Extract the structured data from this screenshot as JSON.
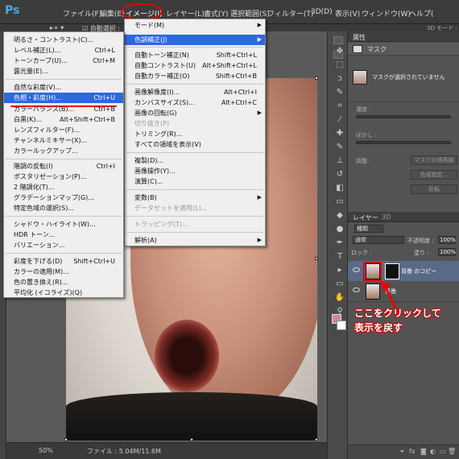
{
  "app": {
    "logo": "Ps",
    "menus": [
      "ファイル(F)",
      "編集(E)",
      "イメージ(I)",
      "レイヤー(L)",
      "書式(Y)",
      "選択範囲(S)",
      "フィルター(T)",
      "3D(D)",
      "表示(V)",
      "ウィンドウ(W)",
      "ヘルプ("
    ]
  },
  "options_bar": {
    "move_tool": "▸+ ▾",
    "auto_select": "☑ 自動選択 :",
    "mode_3d": "3D モード :"
  },
  "image_menu": {
    "items": [
      {
        "label": "モード(M)",
        "shortcut": "",
        "submenu": true,
        "disabled": false
      },
      {
        "label": "色調補正(J)",
        "shortcut": "",
        "submenu": true,
        "disabled": false,
        "highlight": true
      },
      {
        "label": "自動トーン補正(N)",
        "shortcut": "Shift+Ctrl+L",
        "disabled": false
      },
      {
        "label": "自動コントラスト(U)",
        "shortcut": "Alt+Shift+Ctrl+L",
        "disabled": false
      },
      {
        "label": "自動カラー補正(O)",
        "shortcut": "Shift+Ctrl+B",
        "disabled": false
      },
      {
        "label": "画像解像度(I)...",
        "shortcut": "Alt+Ctrl+I",
        "disabled": false
      },
      {
        "label": "カンバスサイズ(S)...",
        "shortcut": "Alt+Ctrl+C",
        "disabled": false
      },
      {
        "label": "画像の回転(G)",
        "shortcut": "",
        "submenu": true,
        "disabled": false
      },
      {
        "label": "切り抜き(P)",
        "shortcut": "",
        "disabled": true
      },
      {
        "label": "トリミング(R)...",
        "shortcut": "",
        "disabled": false
      },
      {
        "label": "すべての領域を表示(V)",
        "shortcut": "",
        "disabled": false
      },
      {
        "label": "複製(D)...",
        "shortcut": "",
        "disabled": false
      },
      {
        "label": "画像操作(Y)...",
        "shortcut": "",
        "disabled": false
      },
      {
        "label": "演算(C)...",
        "shortcut": "",
        "disabled": false
      },
      {
        "label": "変数(B)",
        "shortcut": "",
        "submenu": true,
        "disabled": false
      },
      {
        "label": "データセットを適用(L)...",
        "shortcut": "",
        "disabled": true
      },
      {
        "label": "トラッピング(T)...",
        "shortcut": "",
        "disabled": true
      },
      {
        "label": "解析(A)",
        "shortcut": "",
        "submenu": true,
        "disabled": false
      }
    ]
  },
  "adjust_menu": {
    "items": [
      {
        "label": "明るさ・コントラスト(C)...",
        "shortcut": ""
      },
      {
        "label": "レベル補正(L)...",
        "shortcut": "Ctrl+L"
      },
      {
        "label": "トーンカーブ(U)...",
        "shortcut": "Ctrl+M"
      },
      {
        "label": "露光量(E)...",
        "shortcut": ""
      },
      {
        "label": "自然な彩度(V)...",
        "shortcut": ""
      },
      {
        "label": "色相・彩度(H)...",
        "shortcut": "Ctrl+U",
        "highlight": true
      },
      {
        "label": "カラーバランス(B)...",
        "shortcut": "Ctrl+B"
      },
      {
        "label": "白黒(K)...",
        "shortcut": "Alt+Shift+Ctrl+B"
      },
      {
        "label": "レンズフィルター(F)...",
        "shortcut": ""
      },
      {
        "label": "チャンネルミキサー(X)...",
        "shortcut": ""
      },
      {
        "label": "カラールックアップ...",
        "shortcut": ""
      },
      {
        "label": "階調の反転(I)",
        "shortcut": "Ctrl+I"
      },
      {
        "label": "ポスタリゼーション(P)...",
        "shortcut": ""
      },
      {
        "label": "2 階調化(T)...",
        "shortcut": ""
      },
      {
        "label": "グラデーションマップ(G)...",
        "shortcut": ""
      },
      {
        "label": "特定色域の選択(S)...",
        "shortcut": ""
      },
      {
        "label": "シャドウ・ハイライト(W)...",
        "shortcut": ""
      },
      {
        "label": "HDR トーン...",
        "shortcut": ""
      },
      {
        "label": "バリエーション...",
        "shortcut": ""
      },
      {
        "label": "彩度を下げる(D)",
        "shortcut": "Shift+Ctrl+U"
      },
      {
        "label": "カラーの適用(M)...",
        "shortcut": ""
      },
      {
        "label": "色の置き換え(R)...",
        "shortcut": ""
      },
      {
        "label": "平均化 (イコライズ)(Q)",
        "shortcut": ""
      }
    ]
  },
  "properties_panel": {
    "tab": "属性",
    "mask_label": "マスク",
    "no_mask": "マスクが選択されていません",
    "density": "濃度 :",
    "feather": "ぼかし :",
    "adjust": "調整 :",
    "mask_edge": "マスクの境界線",
    "color_range": "色域指定...",
    "invert": "反転"
  },
  "layers_panel": {
    "tab_layers": "レイヤー",
    "tab_3d": "3D",
    "kind": "種類",
    "blend": "通常",
    "opacity_label": "不透明度 :",
    "opacity": "100%",
    "lock_label": "ロック :",
    "fill_label": "塗り :",
    "fill": "100%",
    "layers": [
      {
        "name": "背景 のコピー",
        "selected": true
      },
      {
        "name": "背景",
        "selected": false
      }
    ]
  },
  "annotation": {
    "line1": "ここをクリックして",
    "line2": "表示を戻す"
  },
  "status": {
    "zoom": "50%",
    "doc": "ファイル : 5.04M/11.6M"
  }
}
